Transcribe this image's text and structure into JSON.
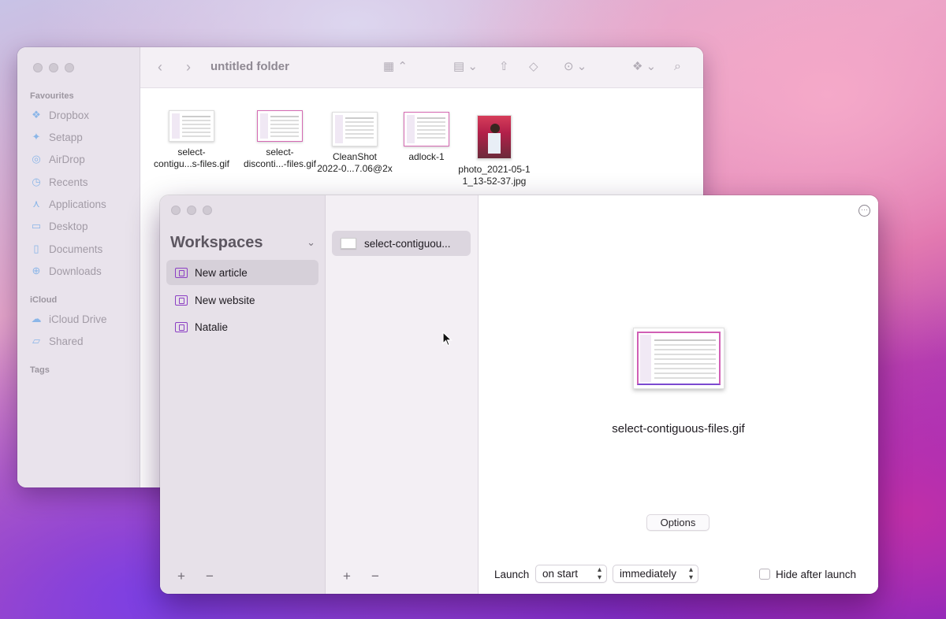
{
  "finder": {
    "title": "untitled folder",
    "sidebar": {
      "favourites_heading": "Favourites",
      "favourites": [
        {
          "label": "Dropbox",
          "icon": "dropbox-icon"
        },
        {
          "label": "Setapp",
          "icon": "setapp-icon"
        },
        {
          "label": "AirDrop",
          "icon": "airdrop-icon"
        },
        {
          "label": "Recents",
          "icon": "clock-icon"
        },
        {
          "label": "Applications",
          "icon": "applications-icon"
        },
        {
          "label": "Desktop",
          "icon": "desktop-icon"
        },
        {
          "label": "Documents",
          "icon": "document-icon"
        },
        {
          "label": "Downloads",
          "icon": "download-icon"
        }
      ],
      "icloud_heading": "iCloud",
      "icloud": [
        {
          "label": "iCloud Drive",
          "icon": "cloud-icon"
        },
        {
          "label": "Shared",
          "icon": "shared-folder-icon"
        }
      ],
      "tags_heading": "Tags"
    },
    "files": [
      {
        "name": "select-\ncontigu...s-files.gif"
      },
      {
        "name": "select-\ndisconti...-files.gif"
      },
      {
        "name": "CleanShot\n2022-0...7.06@2x"
      },
      {
        "name": "adlock-1"
      },
      {
        "name": "photo_2021-05-1\n1_13-52-37.jpg"
      }
    ]
  },
  "app": {
    "workspaces_title": "Workspaces",
    "workspaces": [
      {
        "label": "New article",
        "selected": true
      },
      {
        "label": "New website",
        "selected": false
      },
      {
        "label": "Natalie",
        "selected": false
      }
    ],
    "add_symbol": "+",
    "remove_symbol": "−",
    "files": [
      {
        "label": "select-contiguou..."
      }
    ],
    "preview": {
      "filename": "select-contiguous-files.gif",
      "options_label": "Options"
    },
    "launch": {
      "label": "Launch",
      "when": "on start",
      "delay": "immediately",
      "hide_after_launch_label": "Hide after launch",
      "hide_after_launch": false
    }
  },
  "colors": {
    "accent_purple": "#8c3fc4",
    "selection": "#d6d0d9"
  }
}
